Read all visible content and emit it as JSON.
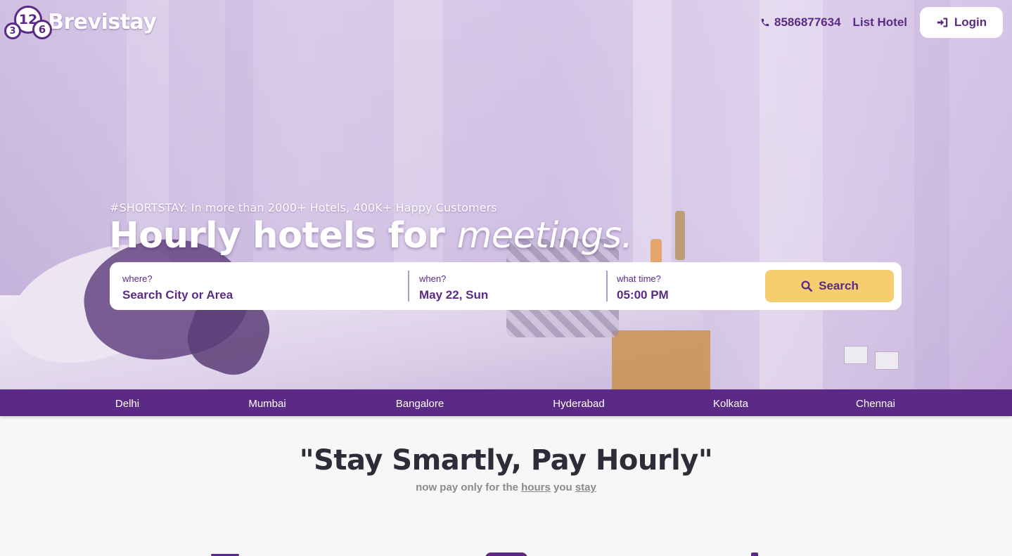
{
  "brand": {
    "logo_numbers": [
      "12",
      "3",
      "6"
    ],
    "name": "Brevistay"
  },
  "header": {
    "phone": "8586877634",
    "list_hotel": "List Hotel",
    "login": "Login"
  },
  "hero": {
    "subtitle": "#SHORTSTAY: In more than 2000+ Hotels, 400K+ Happy Customers",
    "title_prefix": "Hourly hotels for ",
    "title_emphasis": "meetings."
  },
  "search": {
    "where_label": "where?",
    "where_value": "Search City or Area",
    "when_label": "when?",
    "when_value": "May 22, Sun",
    "time_label": "what time?",
    "time_value": "05:00 PM",
    "button": "Search"
  },
  "cities": [
    "Delhi",
    "Mumbai",
    "Bangalore",
    "Hyderabad",
    "Kolkata",
    "Chennai"
  ],
  "section": {
    "tagline": "\"Stay Smartly, Pay Hourly\"",
    "sub_a": "now pay only for the ",
    "sub_hours": "hours",
    "sub_b": " you ",
    "sub_stay": "stay"
  },
  "colors": {
    "brand_purple": "#5b2a86",
    "search_yellow": "#f6cd6f"
  },
  "icons": [
    "phone-icon",
    "login-icon",
    "search-icon"
  ]
}
